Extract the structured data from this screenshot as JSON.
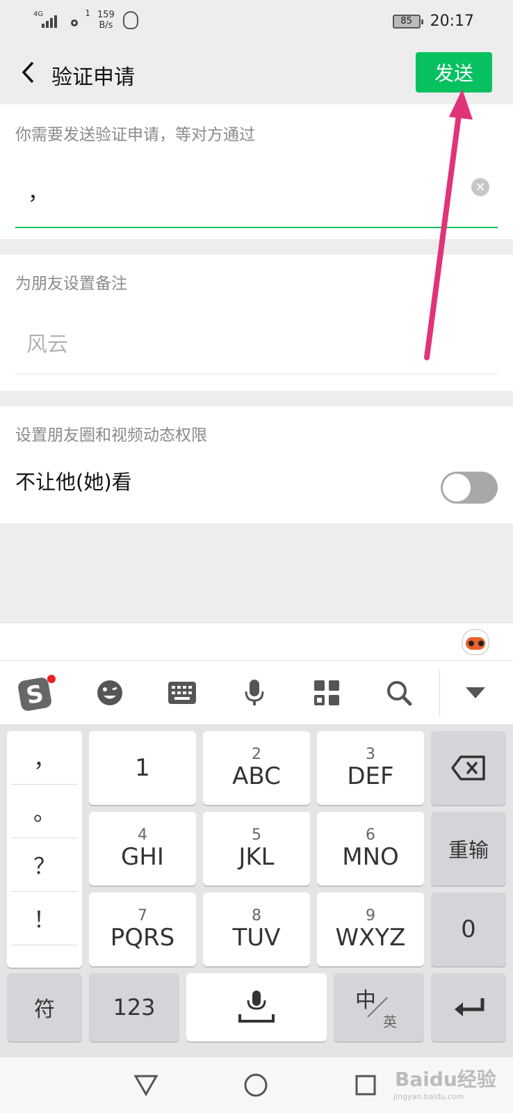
{
  "status_bar": {
    "network_tag": "4G",
    "wifi_sup": "1",
    "speed_value": "159",
    "speed_unit": "B/s",
    "battery": "85",
    "time": "20:17"
  },
  "header": {
    "title": "验证申请",
    "send_label": "发送",
    "accent_color": "#07c160"
  },
  "verify": {
    "hint": "你需要发送验证申请，等对方通过",
    "value": "，"
  },
  "remark": {
    "hint": "为朋友设置备注",
    "placeholder": "风云"
  },
  "privacy": {
    "hint": "设置朋友圈和视频动态权限",
    "row_label": "不让他(她)看",
    "toggle_on": false
  },
  "keyboard": {
    "punctuation": [
      "，",
      "。",
      "？",
      "！"
    ],
    "keys": [
      {
        "num": "",
        "letters": "1"
      },
      {
        "num": "2",
        "letters": "ABC"
      },
      {
        "num": "3",
        "letters": "DEF"
      },
      {
        "num": "4",
        "letters": "GHI"
      },
      {
        "num": "5",
        "letters": "JKL"
      },
      {
        "num": "6",
        "letters": "MNO"
      },
      {
        "num": "7",
        "letters": "PQRS"
      },
      {
        "num": "8",
        "letters": "TUV"
      },
      {
        "num": "9",
        "letters": "WXYZ"
      }
    ],
    "reinput_label": "重输",
    "zero_label": "0",
    "symbol_label": "符",
    "numeric_label": "123",
    "lang_main": "中",
    "lang_sub": "英"
  },
  "watermark": {
    "text": "Baidu经验",
    "sub": "jingyan.baidu.com"
  }
}
